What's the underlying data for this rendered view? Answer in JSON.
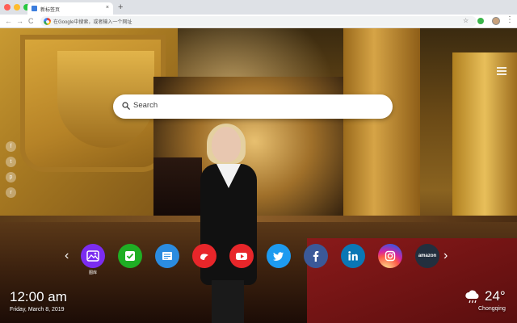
{
  "browser": {
    "tab_title": "新标签页",
    "tab_close": "×",
    "new_tab": "+",
    "nav": {
      "back": "←",
      "forward": "→",
      "reload": "C"
    },
    "address_text": "在Google中搜索，或者输入一个网址",
    "bookmark_icon": "star-icon",
    "menu_icon": "⋮"
  },
  "page": {
    "search_placeholder": "Search",
    "social_icons": [
      "facebook-icon",
      "twitter-icon",
      "pinterest-icon",
      "reddit-icon"
    ],
    "social_glyphs": [
      "f",
      "t",
      "p",
      "r"
    ],
    "prev_arrow": "‹",
    "next_arrow": "›",
    "apps": [
      {
        "name": "gallery",
        "label": "图库",
        "color": "#7b2cf0"
      },
      {
        "name": "checklist",
        "label": "",
        "color": "#1fae24"
      },
      {
        "name": "notes",
        "label": "",
        "color": "#2b8ce0"
      },
      {
        "name": "games",
        "label": "",
        "color": "#e8262a"
      },
      {
        "name": "youtube",
        "label": "",
        "color": "#e8262a"
      },
      {
        "name": "twitter",
        "label": "",
        "color": "#1d9bf0"
      },
      {
        "name": "facebook",
        "label": "",
        "color": "#3b5998"
      },
      {
        "name": "linkedin",
        "label": "",
        "color": "#0a77b5"
      },
      {
        "name": "instagram",
        "label": "",
        "color": "#d6249f"
      },
      {
        "name": "amazon",
        "label": "",
        "color": "#232f3e",
        "text": "amazon"
      }
    ],
    "clock": {
      "time": "12:00 am",
      "date": "Friday, March 8, 2019"
    },
    "weather": {
      "temperature": "24°",
      "city": "Chongqing",
      "icon": "cloud-rain-icon"
    }
  }
}
